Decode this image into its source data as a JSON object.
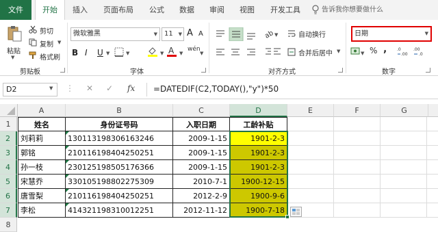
{
  "tabs": {
    "file": "文件",
    "items": [
      "开始",
      "插入",
      "页面布局",
      "公式",
      "数据",
      "审阅",
      "视图",
      "开发工具"
    ],
    "tell_me": "告诉我你想要做什么"
  },
  "ribbon": {
    "clipboard": {
      "paste": "粘贴",
      "cut": "剪切",
      "copy": "复制",
      "format_painter": "格式刷",
      "label": "剪贴板"
    },
    "font": {
      "name": "微软雅黑",
      "size": "11",
      "label": "字体",
      "grow": "A",
      "shrink": "A",
      "bold": "B",
      "italic": "I",
      "underline": "U",
      "wen": "wén"
    },
    "alignment": {
      "wrap": "自动换行",
      "merge": "合并后居中",
      "label": "对齐方式"
    },
    "number": {
      "format": "日期",
      "label": "数字",
      "percent": "%",
      "comma": ","
    }
  },
  "formula_bar": {
    "name_box": "D2",
    "fx": "fx",
    "formula": "=DATEDIF(C2,TODAY(),\"y\")*50"
  },
  "grid": {
    "columns": [
      "A",
      "B",
      "C",
      "D",
      "E",
      "F",
      "G"
    ],
    "rows": [
      "1",
      "2",
      "3",
      "4",
      "5",
      "6",
      "7",
      "8",
      "9"
    ],
    "selected_column": "D",
    "header": {
      "a": "姓名",
      "b": "身份证号码",
      "c": "入职日期",
      "d": "工龄补贴"
    },
    "records": [
      {
        "a": "刘莉莉",
        "b": "130113198306163246",
        "c": "2009-1-15",
        "d": "1901-2-3"
      },
      {
        "a": "郭铭",
        "b": "210116198404250251",
        "c": "2009-1-15",
        "d": "1901-2-3"
      },
      {
        "a": "孙一枝",
        "b": "230125198505176366",
        "c": "2009-1-15",
        "d": "1901-2-3"
      },
      {
        "a": "宋慧乔",
        "b": "330105198802275309",
        "c": "2010-7-1",
        "d": "1900-12-15"
      },
      {
        "a": "唐雪梨",
        "b": "210116198404250251",
        "c": "2012-2-9",
        "d": "1900-9-6"
      },
      {
        "a": "李松",
        "b": "414321198310012251",
        "c": "2012-11-12",
        "d": "1900-7-18"
      }
    ]
  },
  "colors": {
    "excel_green": "#217346",
    "highlight_yellow": "#ffff00",
    "selected_olive": "#cdc800"
  }
}
